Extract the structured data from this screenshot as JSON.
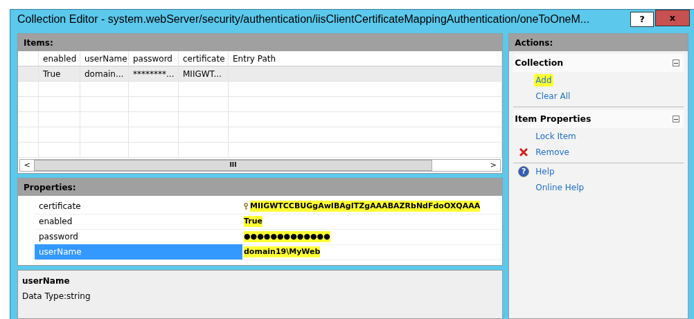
{
  "window": {
    "title": "Collection Editor - system.webServer/security/authentication/iisClientCertificateMappingAuthentication/oneToOneM...",
    "buttons": [
      {
        "kind": "help",
        "label": "?"
      },
      {
        "kind": "close",
        "label": "x"
      }
    ]
  },
  "items": {
    "header": "Items:",
    "columns": [
      "enabled",
      "userName",
      "password",
      "certificate",
      "Entry Path"
    ],
    "rows": [
      {
        "selected": true,
        "cells": [
          "True",
          "domain...",
          "********...",
          "MIIGWT...",
          null
        ]
      }
    ],
    "scrollbar": {
      "left": "<",
      "right": ">",
      "grip": "III"
    }
  },
  "properties": {
    "header": "Properties:",
    "rows": [
      {
        "name": "certificate",
        "value": "MIIGWTCCBUGgAwIBAgITZgAAABAZRbNdFdoOXQAAA",
        "selected": false,
        "highlighted": true,
        "kind": "key"
      },
      {
        "name": "enabled",
        "value": "True",
        "selected": false,
        "highlighted": true,
        "kind": "plain"
      },
      {
        "name": "password",
        "value": "●●●●●●●●●●●●●",
        "selected": false,
        "highlighted": true,
        "kind": "plain"
      },
      {
        "name": "userName",
        "value": "domain19\\MyWeb",
        "selected": true,
        "highlighted": true,
        "kind": "plain"
      }
    ]
  },
  "description": {
    "title": "userName",
    "text": "Data Type:string"
  },
  "actions": {
    "header": "Actions:",
    "sections": [
      {
        "title": "Collection",
        "expanded": true,
        "items": [
          {
            "label": "Add",
            "kind": "plain",
            "highlighted": true
          },
          {
            "label": "Clear All",
            "kind": "plain",
            "highlighted": false
          }
        ]
      },
      {
        "title": "Item Properties",
        "expanded": true,
        "items": [
          {
            "label": "Lock Item",
            "kind": "plain",
            "highlighted": false
          },
          {
            "label": "Remove",
            "kind": "remove",
            "highlighted": false
          }
        ]
      },
      {
        "items": [
          {
            "label": "Help",
            "kind": "help",
            "icon": "?",
            "highlighted": false
          },
          {
            "label": "Online Help",
            "kind": "plain",
            "highlighted": false
          }
        ]
      }
    ]
  }
}
